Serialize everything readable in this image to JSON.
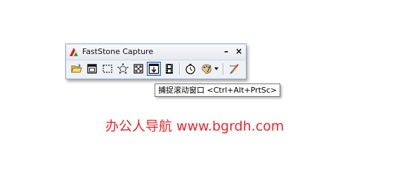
{
  "window": {
    "title": "FastStone Capture",
    "minimize_label": "–",
    "close_label": "×"
  },
  "toolbar": {
    "buttons": [
      {
        "name": "open-file",
        "icon": "open-folder-icon"
      },
      {
        "name": "capture-active-window",
        "icon": "window-icon"
      },
      {
        "name": "capture-rectangle",
        "icon": "rectangle-select-icon"
      },
      {
        "name": "capture-freehand",
        "icon": "freehand-select-icon"
      },
      {
        "name": "capture-full-screen",
        "icon": "full-screen-icon"
      },
      {
        "name": "capture-scrolling-window",
        "icon": "scrolling-window-icon",
        "active": true
      },
      {
        "name": "screen-recorder",
        "icon": "film-icon"
      },
      {
        "name": "delay-capture",
        "icon": "timer-icon"
      },
      {
        "name": "output-destination",
        "icon": "palette-icon",
        "has_dropdown": true
      },
      {
        "name": "settings",
        "icon": "settings-brush-icon"
      }
    ]
  },
  "tooltip": {
    "text": "捕捉滚动窗口 <Ctrl+Alt+PrtSc>"
  },
  "watermark": {
    "text": "办公人导航 www.bgrdh.com",
    "color": "#e8272b"
  }
}
